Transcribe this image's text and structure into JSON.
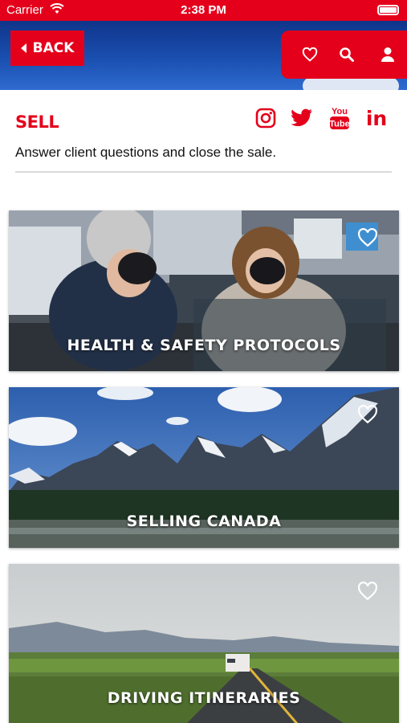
{
  "status_bar": {
    "carrier": "Carrier",
    "time": "2:38 PM"
  },
  "header": {
    "back_label": "BACK"
  },
  "toolbar": {
    "icons": [
      "heart-icon",
      "search-icon",
      "user-icon"
    ]
  },
  "section": {
    "title": "SELL",
    "subtitle": "Answer client questions and close the sale."
  },
  "social": {
    "icons": [
      "instagram-icon",
      "twitter-icon",
      "youtube-icon",
      "linkedin-icon"
    ],
    "youtube_text_top": "You",
    "youtube_text_bottom": "Tube",
    "linkedin_text": "in"
  },
  "cards": [
    {
      "label": "HEALTH & SAFETY PROTOCOLS"
    },
    {
      "label": "SELLING CANADA"
    },
    {
      "label": "DRIVING ITINERARIES"
    }
  ],
  "colors": {
    "brand_red": "#e4001b",
    "header_blue": "#1a4fb0"
  }
}
